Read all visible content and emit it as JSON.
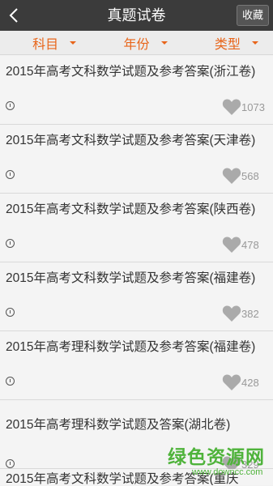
{
  "header": {
    "title": "真题试卷",
    "collect_label": "收藏",
    "back_icon": "chevron-left-icon"
  },
  "filters": [
    {
      "label": "科目"
    },
    {
      "label": "年份"
    },
    {
      "label": "类型"
    }
  ],
  "items": [
    {
      "title": "2015年高考文科数学试题及参考答案(浙江卷)",
      "likes": "1073"
    },
    {
      "title": "2015年高考文科数学试题及参考答案(天津卷)",
      "likes": "568"
    },
    {
      "title": "2015年高考文科数学试题及参考答案(陕西卷)",
      "likes": "478"
    },
    {
      "title": "2015年高考文科数学试题及参考答案(福建卷)",
      "likes": "382"
    },
    {
      "title": "2015年高考理科数学试题及参考答案(福建卷)",
      "likes": "428"
    },
    {
      "title": "2015年高考理科数学试题及答案(湖北卷)",
      "likes": "329"
    },
    {
      "title": "2015年高考文科数学试题及参考答案(重庆"
    }
  ],
  "watermark": {
    "main": "绿色资源网",
    "url": "www.downcc.com"
  },
  "colors": {
    "accent": "#e8651a",
    "topbar": "#3b3b3b",
    "heart": "#aaaaaa"
  }
}
